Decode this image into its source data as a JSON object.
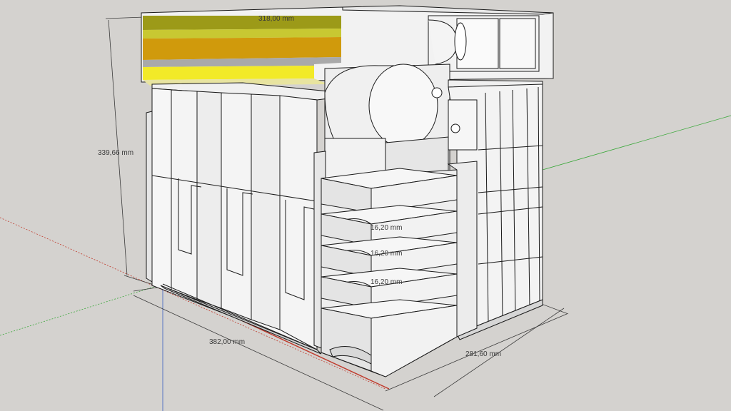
{
  "dimensions": {
    "height_label": "339,66 mm",
    "width_label": "382,00 mm",
    "depth_label": "281,60 mm",
    "top_label": "318,00 mm",
    "drawer_gap_1": "16,20 mm",
    "drawer_gap_2": "16,20 mm",
    "drawer_gap_3": "16,20 mm"
  },
  "colors": {
    "background": "#d4d2cf",
    "panel_face": "#f4f4f4",
    "panel_shade": "#e2e2e2",
    "layer_olive": "#9c9a18",
    "layer_yellow_green": "#c8c832",
    "layer_orange": "#d09a0c",
    "layer_gray": "#a9a9a9",
    "layer_yellow": "#f2ea28",
    "axis_red": "#c0392b",
    "axis_green": "#3aa83a",
    "axis_blue": "#3a5fc0"
  }
}
